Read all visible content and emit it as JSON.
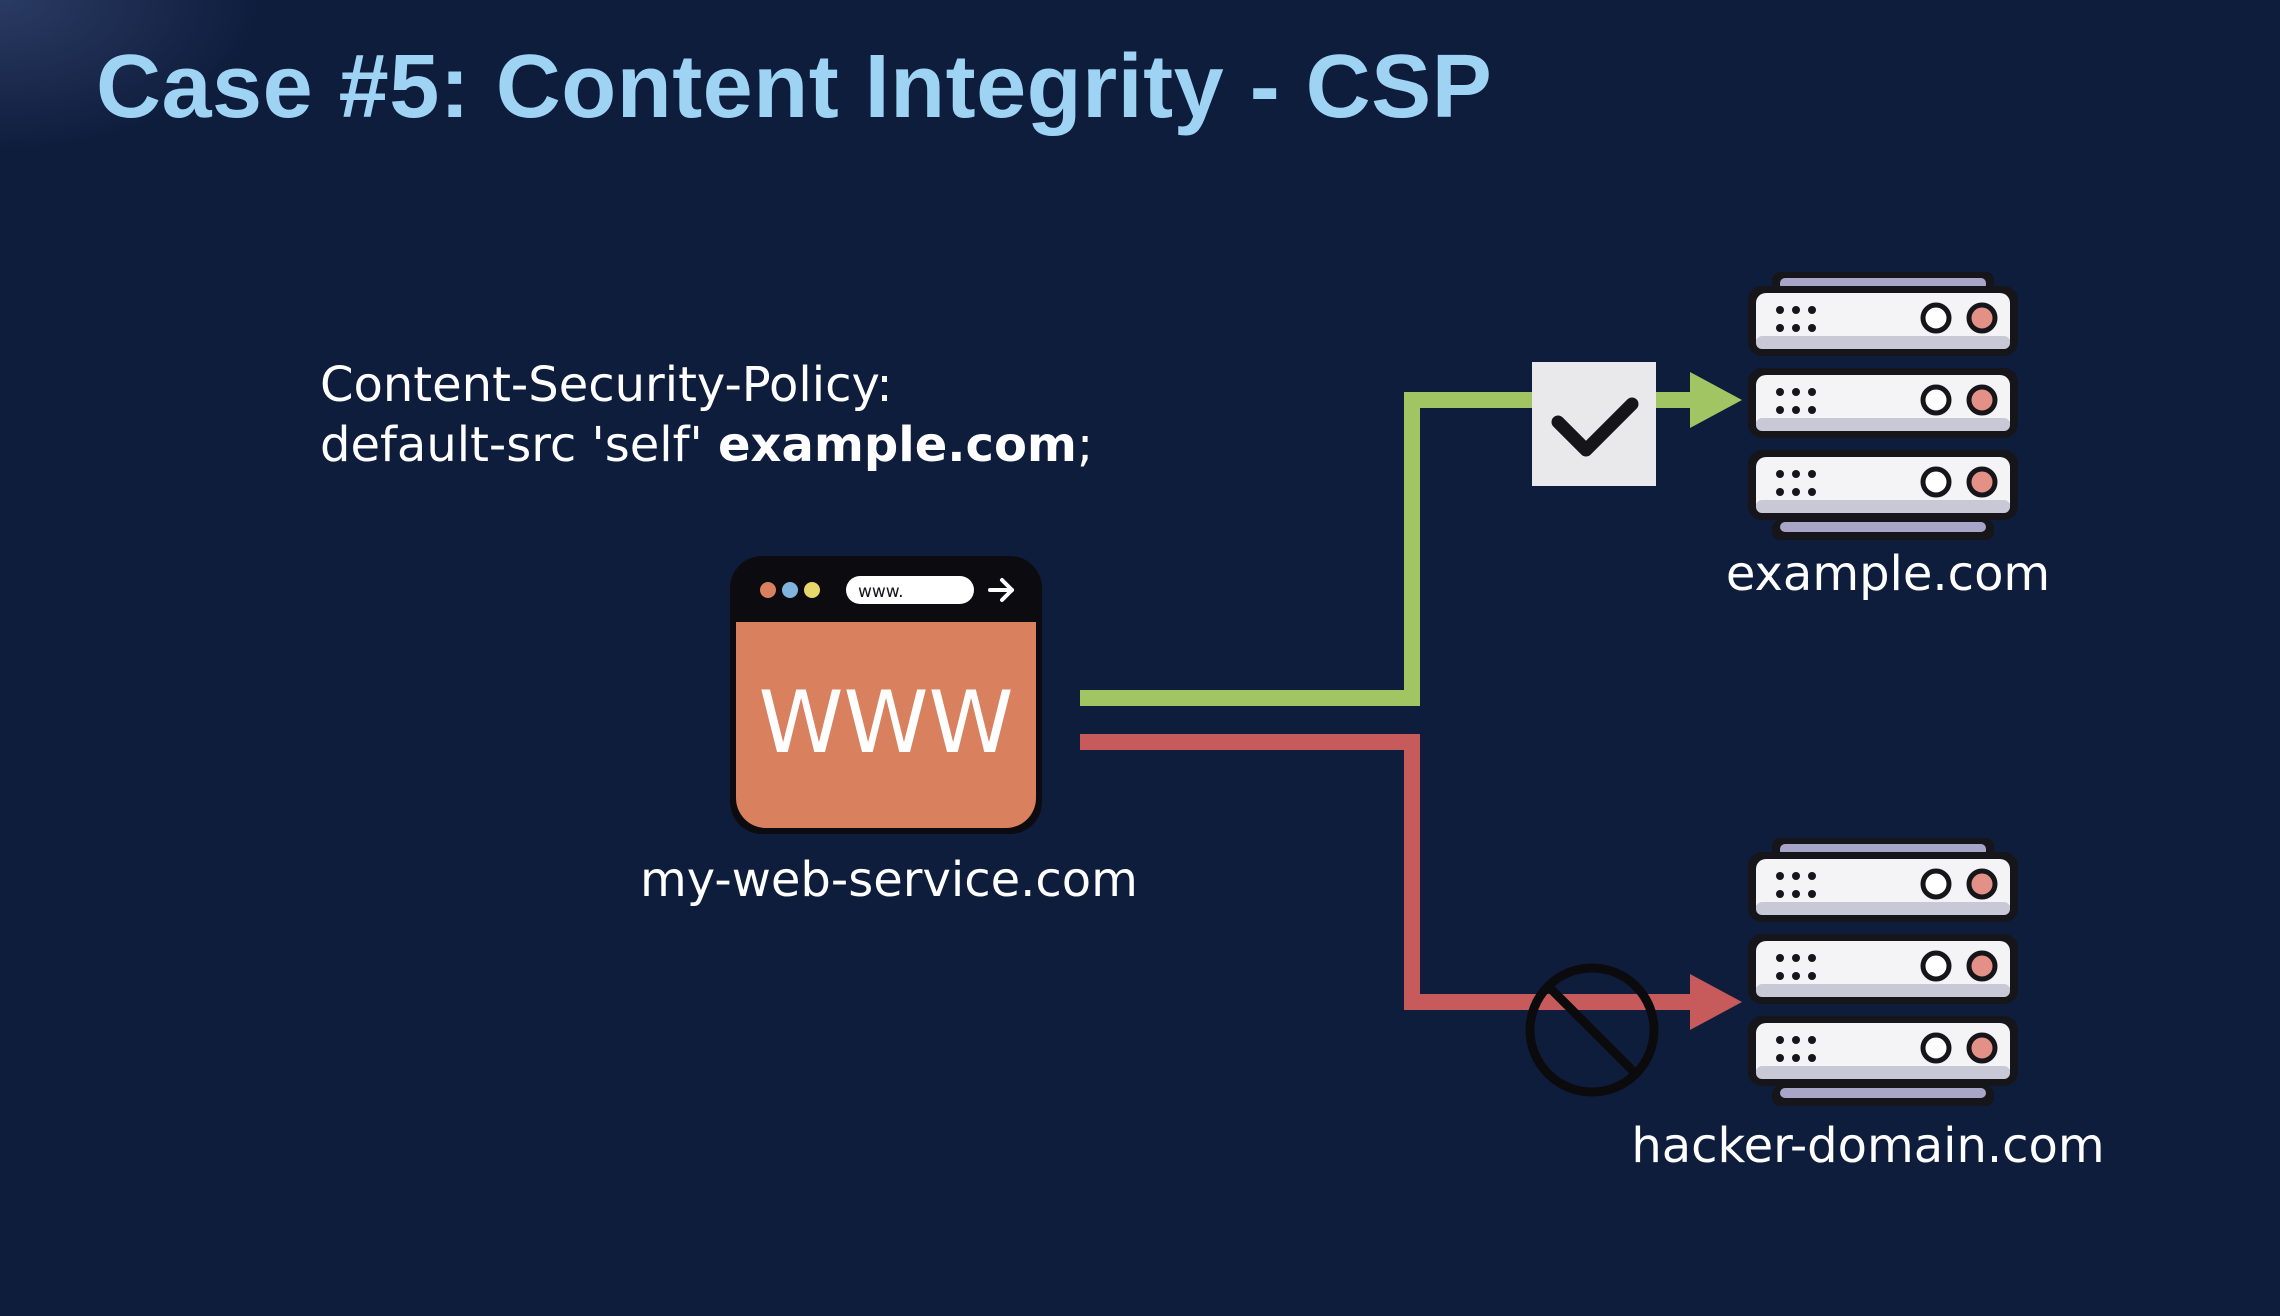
{
  "slide": {
    "title": "Case #5: Content Integrity - CSP",
    "policy_line1": "Content-Security-Policy:",
    "policy_line2_prefix": "default-src 'self' ",
    "policy_line2_bold": "example.com",
    "policy_line2_suffix": ";"
  },
  "browser": {
    "url_text": "www.",
    "logo_text": "WWW",
    "label": "my-web-service.com"
  },
  "servers": {
    "allowed_label": "example.com",
    "blocked_label": "hacker-domain.com"
  },
  "colors": {
    "allowed": "#a2c563",
    "blocked": "#c75a5a",
    "browser_body": "#d9805f"
  },
  "icons": {
    "allowed_marker": "check-icon",
    "blocked_marker": "no-entry-icon",
    "arrow": "arrow-right-icon"
  }
}
